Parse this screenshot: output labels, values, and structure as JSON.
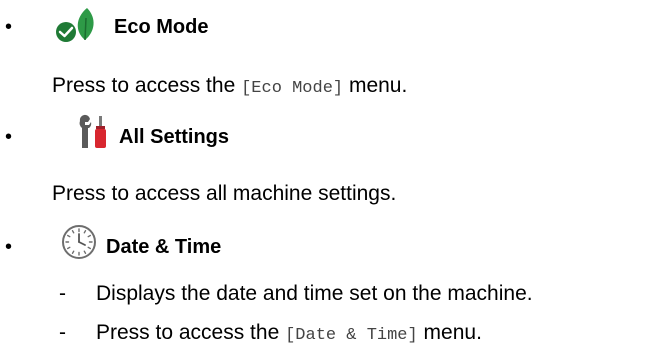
{
  "items": [
    {
      "icon": "eco-leaf-checkmark-icon",
      "title": "Eco Mode",
      "desc_prefix": "Press to access the ",
      "desc_code": "[Eco Mode]",
      "desc_suffix": " menu."
    },
    {
      "icon": "tools-screwdriver-wrench-icon",
      "title": "All Settings",
      "desc": "Press to access all machine settings."
    },
    {
      "icon": "clock-icon",
      "title": "Date & Time",
      "sub_items": [
        {
          "text": "Displays the date and time set on the machine."
        },
        {
          "text_prefix": "Press to access the ",
          "text_code": "[Date & Time]",
          "text_suffix": " menu."
        }
      ]
    }
  ],
  "bullet_char": "•",
  "dash_char": "-",
  "colors": {
    "leaf_green": "#2e9a47",
    "check_green": "#1f7a35",
    "screwdriver_red": "#d8262f",
    "tool_gray": "#5a5a5a",
    "clock_outline": "#6e6e6e"
  }
}
